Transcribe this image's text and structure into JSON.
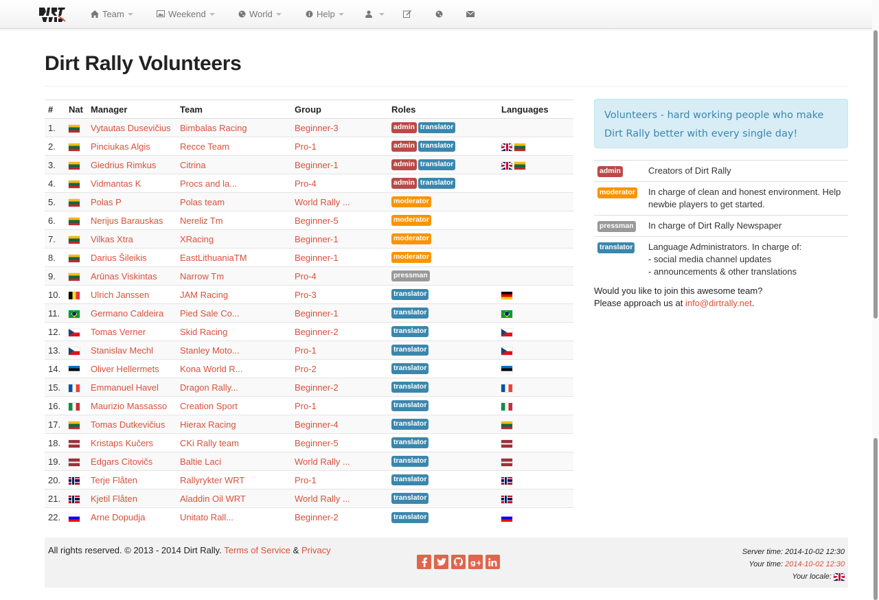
{
  "nav": {
    "items": [
      {
        "label": "Team",
        "icon": "home-icon"
      },
      {
        "label": "Weekend",
        "icon": "picture-icon"
      },
      {
        "label": "World",
        "icon": "globe-icon"
      },
      {
        "label": "Help",
        "icon": "info-icon"
      }
    ]
  },
  "page": {
    "title": "Dirt Rally Volunteers"
  },
  "table": {
    "headers": [
      "#",
      "Nat",
      "Manager",
      "Team",
      "Group",
      "Roles",
      "Languages"
    ],
    "rows": [
      {
        "num": "1.",
        "nat": "lt",
        "manager": "Vytautas Dusevičius",
        "team": "Bimbalas Racing",
        "group": "Beginner-3",
        "roles": [
          "admin",
          "translator"
        ],
        "langs": []
      },
      {
        "num": "2.",
        "nat": "lt",
        "manager": "Pinciukas Algis",
        "team": "Recce Team",
        "group": "Pro-1",
        "roles": [
          "admin",
          "translator"
        ],
        "langs": [
          "gb",
          "lt"
        ]
      },
      {
        "num": "3.",
        "nat": "lt",
        "manager": "Giedrius Rimkus",
        "team": "Citrina",
        "group": "Beginner-1",
        "roles": [
          "admin",
          "translator"
        ],
        "langs": [
          "gb",
          "lt"
        ]
      },
      {
        "num": "4.",
        "nat": "lt",
        "manager": "Vidmantas K",
        "team": "Procs and la...",
        "group": "Pro-4",
        "roles": [
          "admin",
          "translator"
        ],
        "langs": []
      },
      {
        "num": "5.",
        "nat": "lt",
        "manager": "Polas P",
        "team": "Polas team",
        "group": "World Rally ...",
        "roles": [
          "moderator"
        ],
        "langs": []
      },
      {
        "num": "6.",
        "nat": "lt",
        "manager": "Nerijus Barauskas",
        "team": "Nereliz Tm",
        "group": "Beginner-5",
        "roles": [
          "moderator"
        ],
        "langs": []
      },
      {
        "num": "7.",
        "nat": "lt",
        "manager": "Vilkas Xtra",
        "team": "XRacing",
        "group": "Beginner-1",
        "roles": [
          "moderator"
        ],
        "langs": []
      },
      {
        "num": "8.",
        "nat": "lt",
        "manager": "Darius Šileikis",
        "team": "EastLithuaniaTM",
        "group": "Beginner-1",
        "roles": [
          "moderator"
        ],
        "langs": []
      },
      {
        "num": "9.",
        "nat": "lt",
        "manager": "Arūnas Viskintas",
        "team": "Narrow Tm",
        "group": "Pro-4",
        "roles": [
          "pressman"
        ],
        "langs": []
      },
      {
        "num": "10.",
        "nat": "be",
        "manager": "Ulrich Janssen",
        "team": "JAM Racing",
        "group": "Pro-3",
        "roles": [
          "translator"
        ],
        "langs": [
          "de"
        ]
      },
      {
        "num": "11.",
        "nat": "br",
        "manager": "Germano Caldeira",
        "team": "Pied Sale Co...",
        "group": "Beginner-1",
        "roles": [
          "translator"
        ],
        "langs": [
          "br"
        ]
      },
      {
        "num": "12.",
        "nat": "cz",
        "manager": "Tomas Verner",
        "team": "Skid Racing",
        "group": "Beginner-2",
        "roles": [
          "translator"
        ],
        "langs": [
          "cz"
        ]
      },
      {
        "num": "13.",
        "nat": "cz",
        "manager": "Stanislav Mechl",
        "team": "Stanley Moto...",
        "group": "Pro-1",
        "roles": [
          "translator"
        ],
        "langs": [
          "cz"
        ]
      },
      {
        "num": "14.",
        "nat": "ee",
        "manager": "Oliver Hellermets",
        "team": "Kona World R...",
        "group": "Pro-2",
        "roles": [
          "translator"
        ],
        "langs": [
          "ee"
        ]
      },
      {
        "num": "15.",
        "nat": "fr",
        "manager": "Emmanuel Havel",
        "team": "Dragon Rally...",
        "group": "Beginner-2",
        "roles": [
          "translator"
        ],
        "langs": [
          "fr"
        ]
      },
      {
        "num": "16.",
        "nat": "it",
        "manager": "Maurizio Massasso",
        "team": "Creation Sport",
        "group": "Pro-1",
        "roles": [
          "translator"
        ],
        "langs": [
          "it"
        ]
      },
      {
        "num": "17.",
        "nat": "lt",
        "manager": "Tomas Dutkevičius",
        "team": "Hierax Racing",
        "group": "Beginner-4",
        "roles": [
          "translator"
        ],
        "langs": [
          "lt"
        ]
      },
      {
        "num": "18.",
        "nat": "lv",
        "manager": "Kristaps Kučers",
        "team": "CKi Rally team",
        "group": "Beginner-5",
        "roles": [
          "translator"
        ],
        "langs": [
          "lv"
        ]
      },
      {
        "num": "19.",
        "nat": "lv",
        "manager": "Edgars Citovičs",
        "team": "Baltie Laci",
        "group": "World Rally ...",
        "roles": [
          "translator"
        ],
        "langs": [
          "lv"
        ]
      },
      {
        "num": "20.",
        "nat": "no",
        "manager": "Terje Flåten",
        "team": "Rallyrykter WRT",
        "group": "Pro-1",
        "roles": [
          "translator"
        ],
        "langs": [
          "no"
        ]
      },
      {
        "num": "21.",
        "nat": "no",
        "manager": "Kjetil Flåten",
        "team": "Aladdin Oil WRT",
        "group": "World Rally ...",
        "roles": [
          "translator"
        ],
        "langs": [
          "no"
        ]
      },
      {
        "num": "22.",
        "nat": "si",
        "manager": "Arne Dopudja",
        "team": "Unitato Rall...",
        "group": "Beginner-2",
        "roles": [
          "translator"
        ],
        "langs": [
          "si"
        ]
      }
    ]
  },
  "alert": {
    "text": "Volunteers - hard working people who make Dirt Rally better with every single day!"
  },
  "legend": [
    {
      "role": "admin",
      "text": "Creators of Dirt Rally"
    },
    {
      "role": "moderator",
      "text": "In charge of clean and honest environment. Help newbie players to get started."
    },
    {
      "role": "pressman",
      "text": "In charge of Dirt Rally Newspaper"
    },
    {
      "role": "translator",
      "text": "Language Administrators. In charge of:",
      "lines": [
        "- social media channel updates",
        "- announcements & other translations"
      ]
    }
  ],
  "join": {
    "line1": "Would you like to join this awesome team?",
    "line2_prefix": "Please approach us at ",
    "email": "info@dirtrally.net",
    "line2_suffix": "."
  },
  "footer": {
    "rights": "All rights reserved. © 2013 - 2014 Dirt Rally.",
    "terms": "Terms of Service",
    "amp": "&",
    "privacy": "Privacy",
    "server_time_label": "Server time:",
    "server_time": "2014-10-02 12:30",
    "your_time_label": "Your time:",
    "your_time": "2014-10-02 12:30",
    "locale_label": "Your locale:",
    "social": [
      "facebook-icon",
      "twitter-icon",
      "github-icon",
      "google-plus-icon",
      "linkedin-icon"
    ]
  },
  "colors": {
    "link": "#d8513c",
    "admin": "#b94a48",
    "translator": "#3a87ad",
    "moderator": "#f89406",
    "pressman": "#999999"
  }
}
